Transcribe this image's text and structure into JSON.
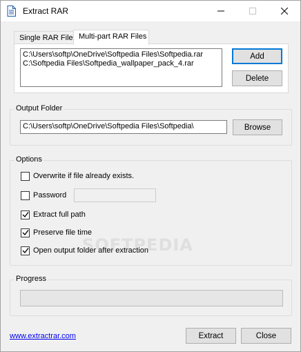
{
  "window": {
    "title": "Extract RAR",
    "icon": "document-icon",
    "controls": {
      "minimize": "minimize-icon",
      "maximize": "maximize-icon",
      "close": "close-icon"
    }
  },
  "tabs": [
    {
      "label": "Single RAR File",
      "active": false
    },
    {
      "label": "Multi-part RAR Files",
      "active": true
    }
  ],
  "files": {
    "items": [
      "C:\\Users\\softp\\OneDrive\\Softpedia Files\\Softpedia.rar",
      "C:\\Softpedia Files\\Softpedia_wallpaper_pack_4.rar"
    ],
    "add_label": "Add",
    "delete_label": "Delete"
  },
  "output": {
    "group_label": "Output Folder",
    "path": "C:\\Users\\softp\\OneDrive\\Softpedia Files\\Softpedia\\",
    "browse_label": "Browse"
  },
  "options": {
    "group_label": "Options",
    "overwrite": {
      "label": "Overwrite if file already exists.",
      "checked": false
    },
    "password": {
      "label": "Password",
      "checked": false,
      "value": ""
    },
    "extract_full_path": {
      "label": "Extract full path",
      "checked": true
    },
    "preserve_file_time": {
      "label": "Preserve file time",
      "checked": true
    },
    "open_output_folder": {
      "label": "Open output folder after extraction",
      "checked": true
    }
  },
  "progress": {
    "group_label": "Progress",
    "value": 0
  },
  "footer": {
    "link": "www.extractrar.com",
    "extract_label": "Extract",
    "close_label": "Close"
  },
  "watermark": "SOFTPEDIA",
  "colors": {
    "accent": "#0078d7",
    "link": "#0000ee",
    "window_bg": "#f0f0f0"
  }
}
